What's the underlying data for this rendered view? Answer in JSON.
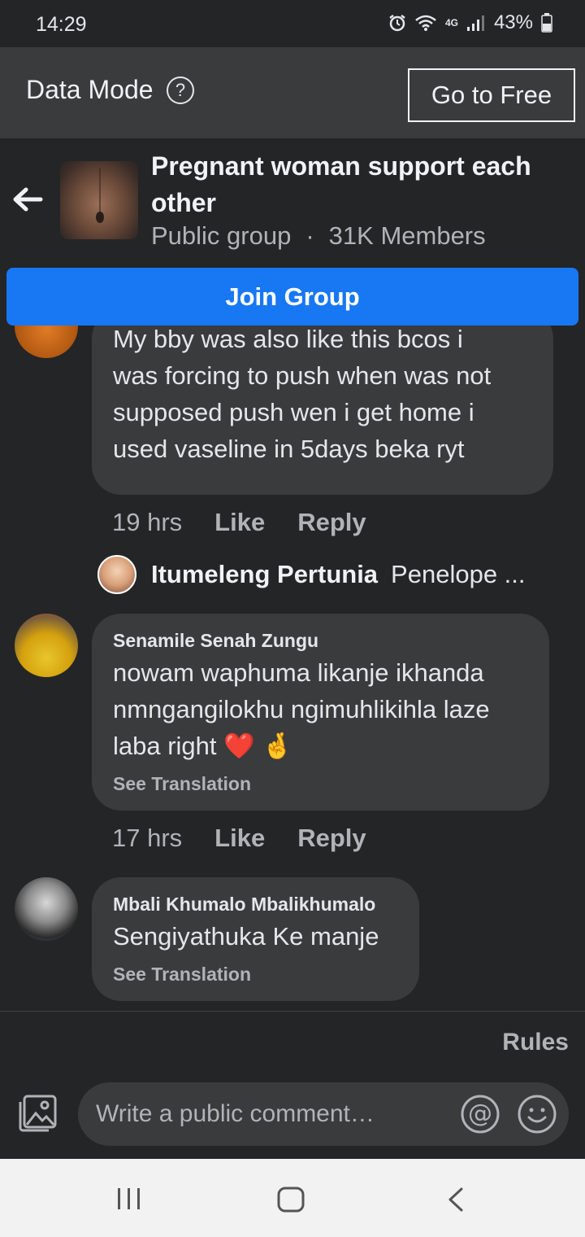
{
  "status_bar": {
    "time": "14:29",
    "network": "4G",
    "battery": "43%"
  },
  "data_mode": {
    "label": "Data Mode",
    "help": "?",
    "go_free_label": "Go to Free"
  },
  "group": {
    "title": "Pregnant woman support each other",
    "privacy": "Public group",
    "separator": "·",
    "members": "31K Members",
    "join_label": "Join Group"
  },
  "comments": [
    {
      "author": "",
      "lines": [
        "My bby was also like this bcos i",
        "was forcing to push when was not",
        "supposed push wen i get home i",
        "used vaseline in 5days beka ryt"
      ],
      "time": "19 hrs",
      "like": "Like",
      "reply": "Reply"
    },
    {
      "author": "Senamile Senah Zungu",
      "lines": [
        "nowam waphuma likanje ikhanda",
        "nmngangilokhu ngimuhlikihla laze",
        "laba right ❤️ 🤞"
      ],
      "see_translation": "See Translation",
      "time": "17 hrs",
      "like": "Like",
      "reply": "Reply"
    },
    {
      "author": "Mbali Khumalo Mbalikhumalo",
      "lines": [
        "Sengiyathuka Ke manje"
      ],
      "see_translation": "See Translation"
    }
  ],
  "reply_preview": {
    "name": "Itumeleng Pertunia",
    "text": "Penelope ..."
  },
  "rules_label": "Rules",
  "composer": {
    "placeholder": "Write a public comment…"
  },
  "icons": {
    "back": "arrow-left-icon",
    "photo": "photo-icon",
    "mention": "at-icon",
    "emoji": "smile-icon",
    "nav_recent": "recent-apps-icon",
    "nav_home": "home-icon",
    "nav_back": "chevron-left-icon"
  },
  "colors": {
    "background": "#242526",
    "join_button": "#1877f2",
    "bubble": "#3a3b3c"
  }
}
